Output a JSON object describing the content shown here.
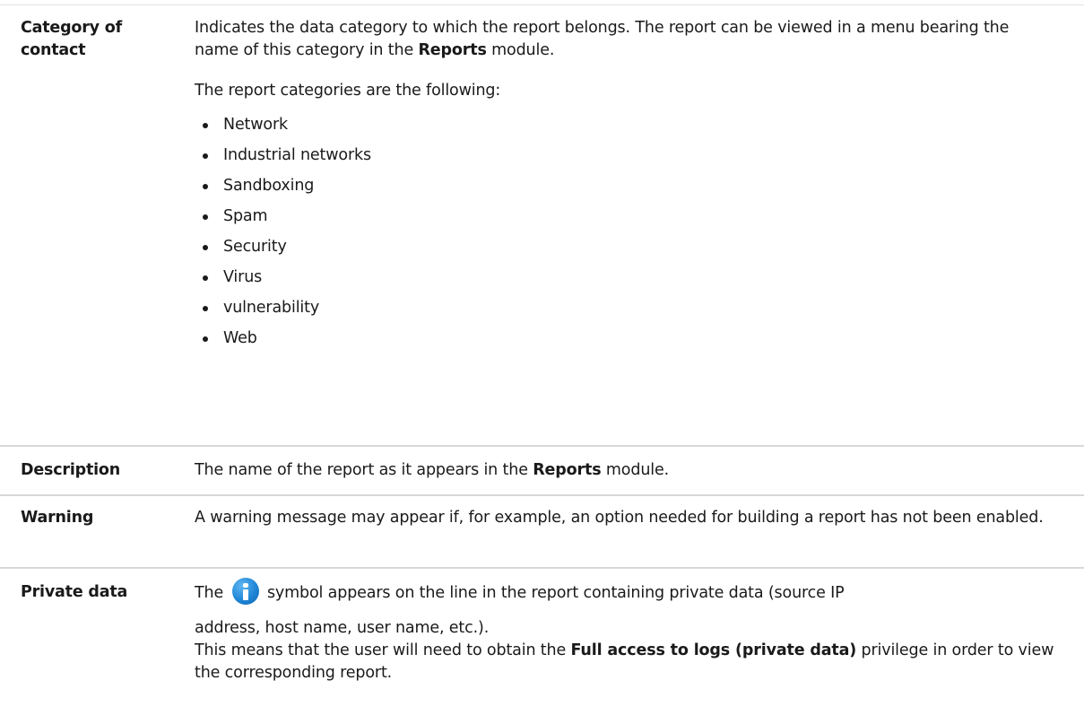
{
  "rows": {
    "category": {
      "term": "Category of contact",
      "intro_1": "Indicates the data category to which the report belongs. The report can be viewed in a menu bearing the name of this category in the ",
      "intro_bold": "Reports",
      "intro_2": " module.",
      "list_intro": "The report categories are the following:",
      "items": [
        "Network",
        "Industrial networks",
        "Sandboxing",
        "Spam",
        "Security",
        "Virus",
        "vulnerability",
        "Web"
      ]
    },
    "description": {
      "term": "Description",
      "text_1": "The name of the report as it appears in the ",
      "text_bold": "Reports",
      "text_2": " module."
    },
    "warning": {
      "term": "Warning",
      "text": "A warning message may appear if, for example, an option needed for building a report has not been enabled."
    },
    "private": {
      "term": "Private data",
      "text_1": "The",
      "icon": "info-icon",
      "text_2": "symbol appears on the line in the report containing private data (source IP",
      "text_3": "address, host name, user name, etc.).",
      "text_4": "This means that the user will need to obtain the ",
      "text_bold": "Full access to logs (private data)",
      "text_5": " privilege in order to view the corresponding report."
    }
  }
}
